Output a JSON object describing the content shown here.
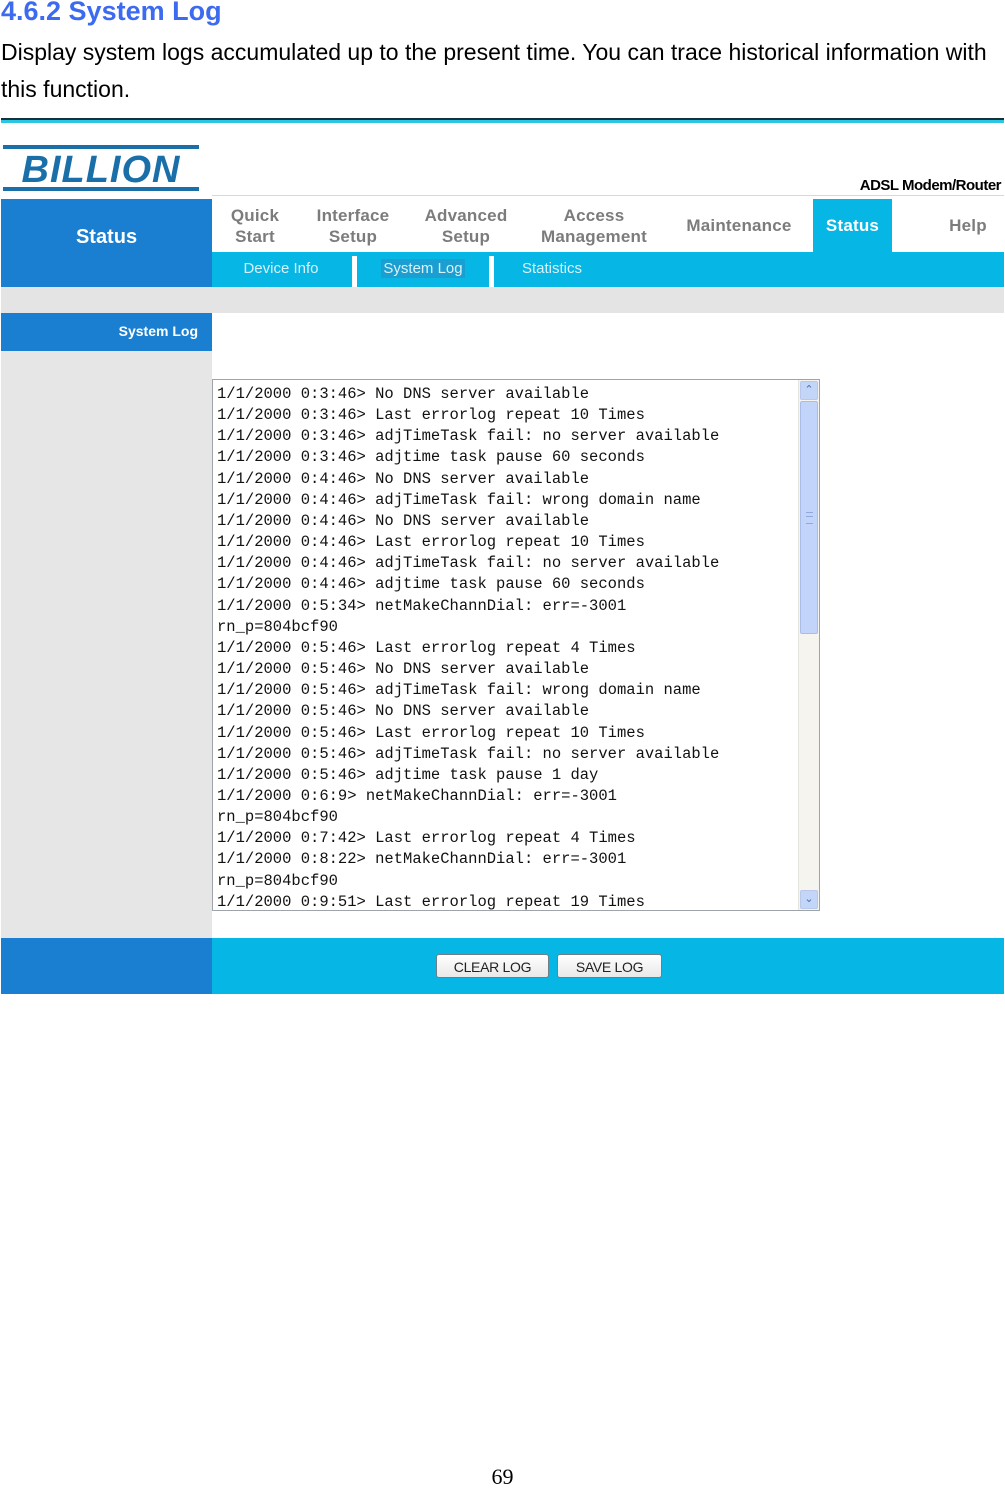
{
  "doc": {
    "heading": "4.6.2 System Log",
    "paragraph": "Display system logs accumulated up to the present time. You can trace historical information with this function.",
    "page_number": "69"
  },
  "router": {
    "brand": "BILLION",
    "product": "ADSL Modem/Router",
    "side_section": "Status",
    "side_page": "System Log",
    "main_nav": [
      {
        "label": "Quick\nStart",
        "active": false
      },
      {
        "label": "Interface\nSetup",
        "active": false
      },
      {
        "label": "Advanced\nSetup",
        "active": false
      },
      {
        "label": "Access\nManagement",
        "active": false
      },
      {
        "label": "Maintenance",
        "active": false
      },
      {
        "label": "Status",
        "active": true
      },
      {
        "label": "Help",
        "active": false
      }
    ],
    "sub_nav": [
      {
        "label": "Device Info",
        "active": false
      },
      {
        "label": "System Log",
        "active": true
      },
      {
        "label": "Statistics",
        "active": false
      }
    ],
    "log_lines": [
      "1/1/2000 0:3:46> No DNS server available",
      "1/1/2000 0:3:46> Last errorlog repeat 10 Times",
      "1/1/2000 0:3:46> adjTimeTask fail: no server available",
      "1/1/2000 0:3:46> adjtime task pause 60 seconds",
      "1/1/2000 0:4:46> No DNS server available",
      "1/1/2000 0:4:46> adjTimeTask fail: wrong domain name",
      "1/1/2000 0:4:46> No DNS server available",
      "1/1/2000 0:4:46> Last errorlog repeat 10 Times",
      "1/1/2000 0:4:46> adjTimeTask fail: no server available",
      "1/1/2000 0:4:46> adjtime task pause 60 seconds",
      "1/1/2000 0:5:34> netMakeChannDial: err=-3001",
      "rn_p=804bcf90",
      "1/1/2000 0:5:46> Last errorlog repeat 4 Times",
      "1/1/2000 0:5:46> No DNS server available",
      "1/1/2000 0:5:46> adjTimeTask fail: wrong domain name",
      "1/1/2000 0:5:46> No DNS server available",
      "1/1/2000 0:5:46> Last errorlog repeat 10 Times",
      "1/1/2000 0:5:46> adjTimeTask fail: no server available",
      "1/1/2000 0:5:46> adjtime task pause 1 day",
      "1/1/2000 0:6:9> netMakeChannDial: err=-3001",
      "rn_p=804bcf90",
      "1/1/2000 0:7:42> Last errorlog repeat 4 Times",
      "1/1/2000 0:8:22> netMakeChannDial: err=-3001",
      "rn_p=804bcf90",
      "1/1/2000 0:9:51> Last errorlog repeat 19 Times"
    ],
    "scroll_icons": {
      "up": "scroll-up-arrow-icon",
      "down": "scroll-down-arrow-icon"
    },
    "buttons": {
      "clear": "CLEAR LOG",
      "save": "SAVE LOG"
    },
    "colors": {
      "side_blue": "#1b7fd1",
      "nav_cyan": "#06b6e4",
      "heading_blue": "#3d6bf0",
      "nav_text_grey": "#7c7c7c",
      "logo_blue": "#1a6fa8"
    }
  }
}
